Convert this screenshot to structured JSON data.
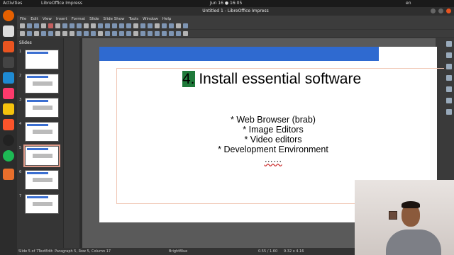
{
  "topbar": {
    "activities": "Activities",
    "app": "LibreOffice Impress",
    "clock": "Jun 16 ● 16:05",
    "lang": "en"
  },
  "window": {
    "title": "Untitled 1 - LibreOffice Impress"
  },
  "menu": [
    "File",
    "Edit",
    "View",
    "Insert",
    "Format",
    "Slide",
    "Slide Show",
    "Tools",
    "Window",
    "Help"
  ],
  "slides_panel": {
    "title": "Slides",
    "numbers": [
      "1",
      "2",
      "3",
      "4",
      "5",
      "6",
      "7"
    ]
  },
  "slide": {
    "title_number": "4.",
    "title_text": " Install essential software",
    "bullets": [
      "* Web Browser (brab)",
      "* Image Editors",
      "* Video editors",
      "* Development Environment"
    ],
    "ellipsis": "……"
  },
  "statusbar": {
    "slide_info": "Slide 5 of 7",
    "edit_info": "TextEdit: Paragraph 5, Row 5, Column 17",
    "master": "BrightBlue",
    "position": "0.55 / 1.60",
    "size": "9.32 x 4.16"
  },
  "colors": {
    "slide_accent": "#2f6ad0",
    "frame_border": "#f0c6b4",
    "highlight": "#1f7a3a"
  }
}
